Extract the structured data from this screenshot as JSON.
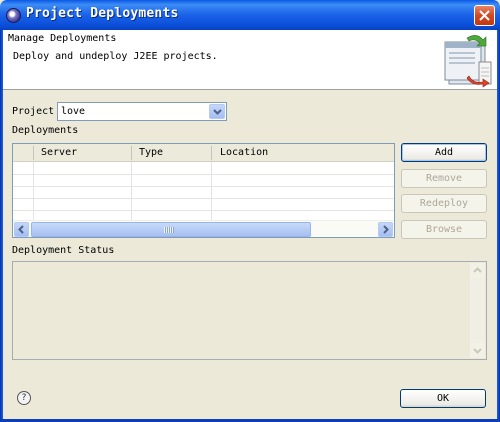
{
  "window": {
    "title": "Project Deployments"
  },
  "header": {
    "title": "Manage Deployments",
    "description": "Deploy and undeploy J2EE projects."
  },
  "project": {
    "label": "Project",
    "selected": "love"
  },
  "deployments": {
    "label": "Deployments",
    "columns": [
      "Server",
      "Type",
      "Location"
    ],
    "rows": []
  },
  "buttons": {
    "add": "Add",
    "remove": "Remove",
    "redeploy": "Redeploy",
    "browse": "Browse",
    "ok": "OK"
  },
  "status": {
    "label": "Deployment Status",
    "text": ""
  },
  "help": {
    "glyph": "?"
  },
  "colors": {
    "titlebar": "#0a58e6",
    "close": "#d04a24",
    "face": "#ece9d8"
  }
}
